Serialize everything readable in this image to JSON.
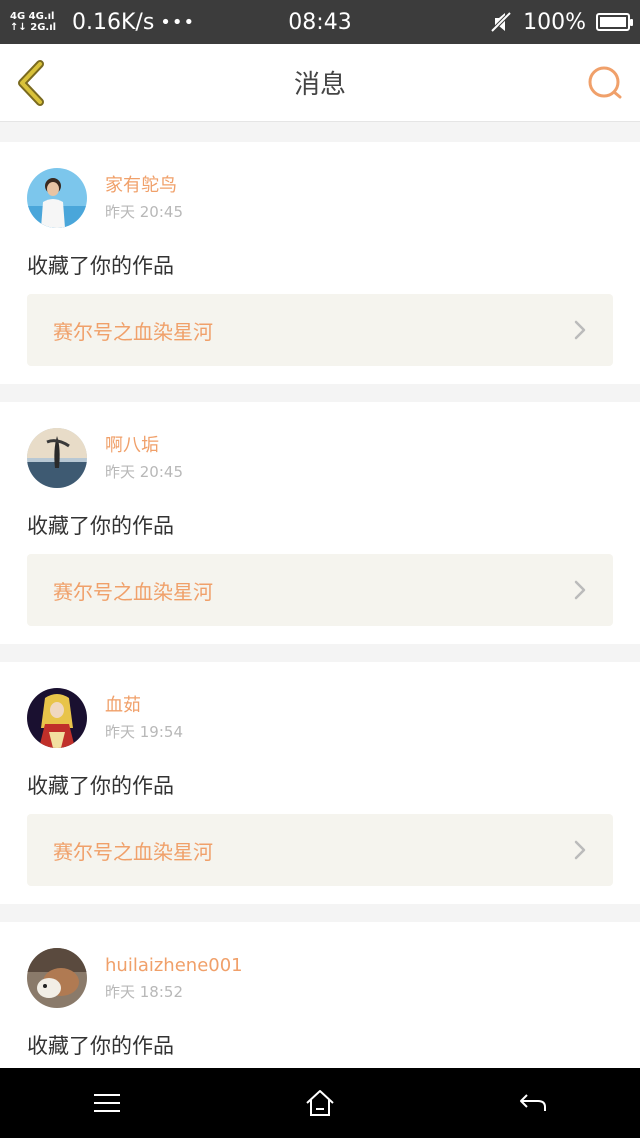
{
  "status_bar": {
    "signal_top": "4G 4G.ıl",
    "signal_bottom": "↑↓ 2G.ıl",
    "speed": "0.16K/s",
    "dots": "•••",
    "time": "08:43",
    "battery": "100%"
  },
  "header": {
    "title": "消息",
    "back_icon": "back-chevron-icon",
    "search_icon": "search-icon"
  },
  "colors": {
    "accent": "#f0a06a",
    "back_icon": "#d9c23a",
    "card_box": "#f5f4ee"
  },
  "messages": [
    {
      "username": "家有鸵鸟",
      "time": "昨天 20:45",
      "action": "收藏了你的作品",
      "work": "赛尔号之血染星河"
    },
    {
      "username": "啊八垢",
      "time": "昨天 20:45",
      "action": "收藏了你的作品",
      "work": "赛尔号之血染星河"
    },
    {
      "username": "血茹",
      "time": "昨天 19:54",
      "action": "收藏了你的作品",
      "work": "赛尔号之血染星河"
    },
    {
      "username": "huilaizhene001",
      "time": "昨天 18:52",
      "action": "收藏了你的作品",
      "work": ""
    }
  ],
  "nav": {
    "menu_icon": "menu-icon",
    "home_icon": "home-icon",
    "back_icon": "back-arrow-icon"
  }
}
